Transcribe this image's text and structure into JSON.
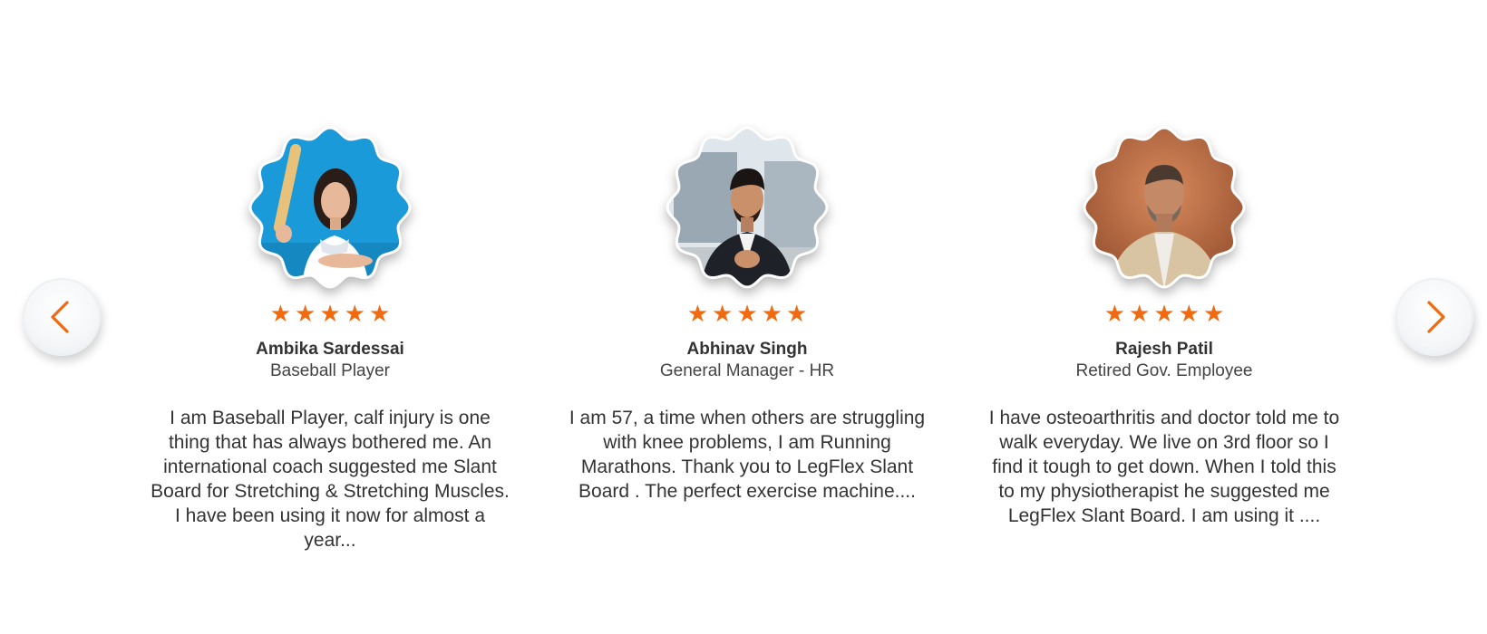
{
  "colors": {
    "accent": "#f26a10",
    "text": "#333333",
    "avatar_1_bg": "#1a9ad8",
    "avatar_2_bg": "#c9d3db",
    "avatar_3_bg": "#b0603a"
  },
  "navigation": {
    "prev_icon": "chevron-left-icon",
    "next_icon": "chevron-right-icon"
  },
  "testimonials": [
    {
      "name": "Ambika Sardessai",
      "role": "Baseball Player",
      "rating": 5,
      "quote": "I am Baseball Player, calf injury is one thing that has always bothered me. An international coach suggested me Slant Board for Stretching & Stretching Muscles. I have been using it now for almost a year..."
    },
    {
      "name": "Abhinav Singh",
      "role": "General Manager - HR",
      "rating": 5,
      "quote": "I am 57, a time when others are struggling with knee problems, I am Running Marathons. Thank you to LegFlex Slant Board . The perfect exercise machine...."
    },
    {
      "name": "Rajesh Patil",
      "role": "Retired Gov. Employee",
      "rating": 5,
      "quote": "I have osteoarthritis and doctor told me to walk everyday. We live on 3rd floor so I find it tough to get down. When I told this to my physiotherapist he suggested me LegFlex Slant Board. I am using it ...."
    }
  ]
}
